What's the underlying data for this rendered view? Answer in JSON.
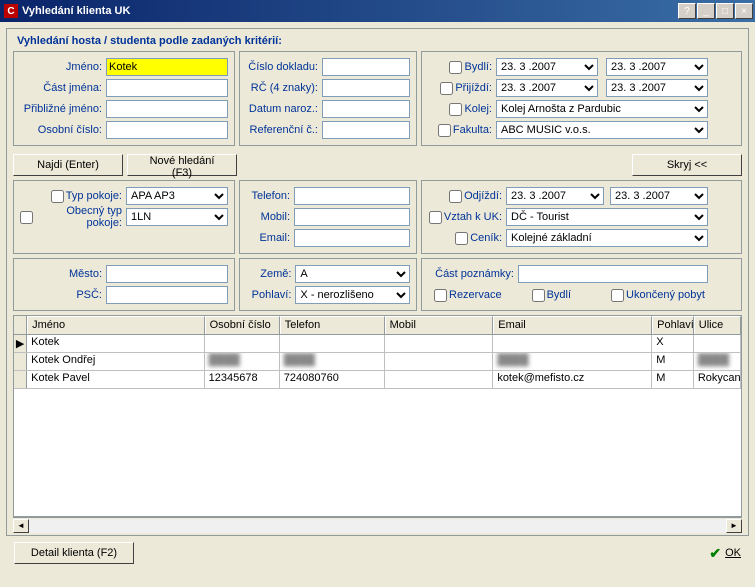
{
  "title": "Vyhledání klienta UK",
  "sectionTitle": "Vyhledání hosta / studenta podle zadaných kritérií:",
  "labels": {
    "jmeno": "Jméno:",
    "castJmena": "Část jména:",
    "priblizneJmeno": "Přibližné jméno:",
    "osobniCislo": "Osobní číslo:",
    "cisloDokladu": "Číslo dokladu:",
    "rc": "RČ (4 znaky):",
    "datumNaroz": "Datum naroz.:",
    "referencniC": "Referenční č.:",
    "bydli": "Bydlí:",
    "prijizdi": "Přijíždí:",
    "kolej": "Kolej:",
    "fakulta": "Fakulta:",
    "typPokoje": "Typ pokoje:",
    "obecnyTyp": "Obecný typ pokoje:",
    "telefon": "Telefon:",
    "mobil": "Mobil:",
    "email": "Email:",
    "odjizdi": "Odjíždí:",
    "vztahUK": "Vztah k UK:",
    "cenik": "Ceník:",
    "mesto": "Město:",
    "psc": "PSČ:",
    "zeme": "Země:",
    "pohlavi": "Pohlaví:",
    "castPoznamky": "Část poznámky:",
    "rezervace": "Rezervace",
    "bydliChk": "Bydlí",
    "ukoncenyPobyt": "Ukončený pobyt"
  },
  "values": {
    "jmeno": "Kotek",
    "typPokoje": "APA AP3",
    "obecnyTyp": "1LN",
    "kolej": "Kolej Arnošta z Pardubic",
    "fakulta": "ABC MUSIC v.o.s.",
    "vztahUK": "DČ - Tourist",
    "cenik": "Kolejné základní",
    "zeme": "A",
    "pohlavi": "X - nerozlišeno",
    "date1": "23. 3 .2007"
  },
  "buttons": {
    "najdi": "Najdi (Enter)",
    "noveHledani": "Nové hledání (F3)",
    "skryj": "Skryj <<",
    "detail": "Detail klienta (F2)",
    "ok": "OK"
  },
  "grid": {
    "headers": [
      "Jméno",
      "Osobní číslo",
      "Telefon",
      "Mobil",
      "Email",
      "Pohlaví",
      "Ulice"
    ],
    "rows": [
      {
        "jmeno": "Kotek",
        "osobni": "",
        "tel": "",
        "mobil": "",
        "email": "",
        "pohlavi": "X",
        "ulice": ""
      },
      {
        "jmeno": "Kotek Ondřej",
        "osobni": "~blur~",
        "tel": "~blur~",
        "mobil": "",
        "email": "~blur~",
        "pohlavi": "M",
        "ulice": "~blur~"
      },
      {
        "jmeno": "Kotek Pavel",
        "osobni": "12345678",
        "tel": "724080760",
        "mobil": "",
        "email": "kotek@mefisto.cz",
        "pohlavi": "M",
        "ulice": "Rokycano"
      }
    ]
  }
}
